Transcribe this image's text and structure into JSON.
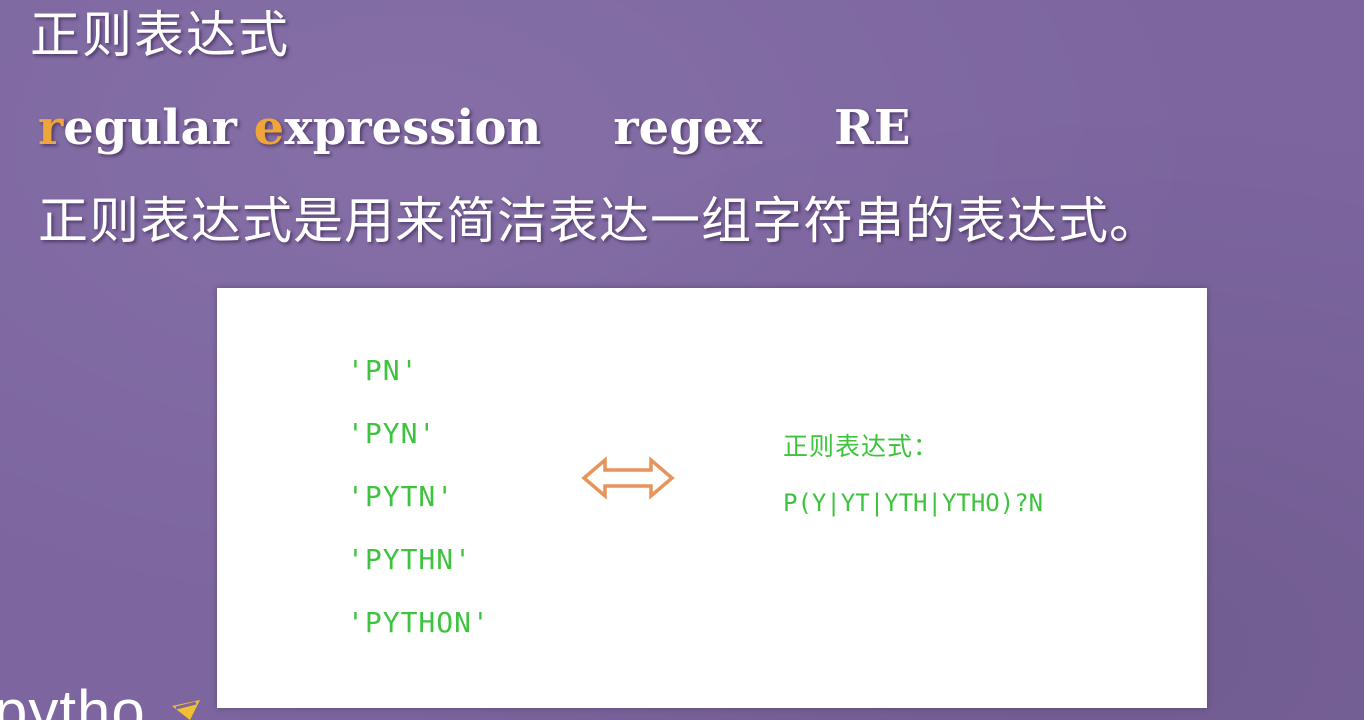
{
  "title": "正则表达式",
  "terms": {
    "full_first_letter": "r",
    "full_word1_rest": "egular ",
    "full_second_letter": "e",
    "full_word2_rest": "xpression",
    "short": "regex",
    "abbrev": "RE"
  },
  "definition": "正则表达式是用来简洁表达一组字符串的表达式。",
  "example": {
    "strings": [
      "'PN'",
      "'PYN'",
      "'PYTN'",
      "'PYTHN'",
      "'PYTHON'"
    ],
    "regex_label": "正则表达式：",
    "regex_value": "P(Y|YT|YTH|YTHO)?N"
  },
  "logo": {
    "text": "pytho"
  },
  "colors": {
    "background": "#7d66a0",
    "accent": "#f0a53a",
    "code_green": "#3ec33e",
    "arrow_orange": "#e8935a"
  },
  "icons": {
    "equivalence": "double-arrow-icon"
  }
}
